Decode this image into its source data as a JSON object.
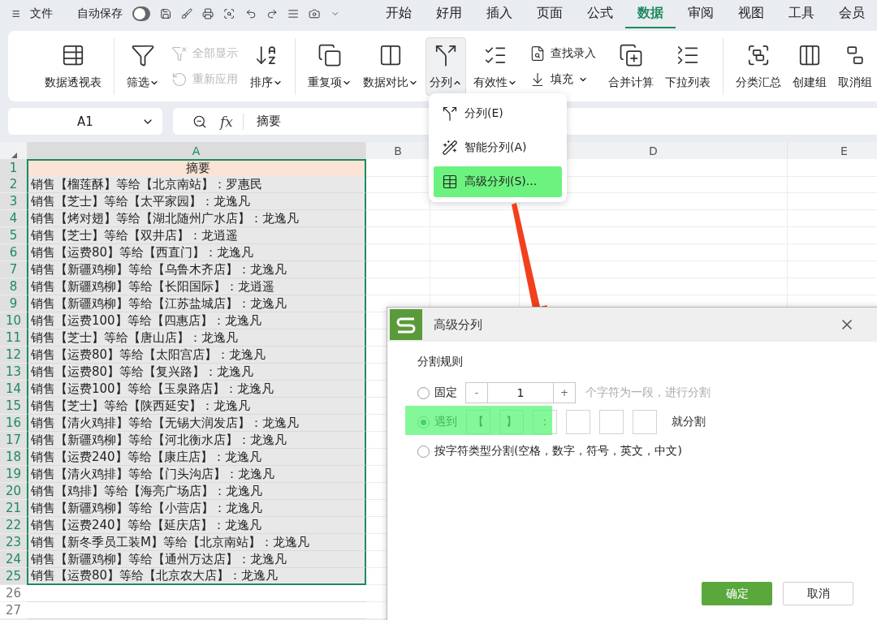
{
  "top_bar": {
    "file_menu": "文件",
    "autosave": {
      "label": "自动保存",
      "on": false
    },
    "tabs": [
      {
        "label": "开始",
        "selected": false
      },
      {
        "label": "好用",
        "selected": false
      },
      {
        "label": "插入",
        "selected": false
      },
      {
        "label": "页面",
        "selected": false
      },
      {
        "label": "公式",
        "selected": false
      },
      {
        "label": "数据",
        "selected": true
      },
      {
        "label": "审阅",
        "selected": false
      },
      {
        "label": "视图",
        "selected": false
      },
      {
        "label": "工具",
        "selected": false
      },
      {
        "label": "会员",
        "selected": false
      }
    ]
  },
  "ribbon": {
    "groups": [
      {
        "items": [
          {
            "kind": "large",
            "label": "数据透视表"
          }
        ]
      },
      {
        "items": [
          {
            "kind": "large",
            "label": "筛选",
            "expanded": false
          },
          {
            "kind": "stack",
            "items": [
              {
                "label": "全部显示",
                "disabled": true
              },
              {
                "label": "重新应用",
                "disabled": true
              }
            ]
          },
          {
            "kind": "large",
            "label": "排序",
            "expanded": false
          }
        ]
      },
      {
        "items": [
          {
            "kind": "large",
            "label": "重复项",
            "expanded": false
          },
          {
            "kind": "large",
            "label": "数据对比",
            "expanded": false
          },
          {
            "kind": "large",
            "label": "分列",
            "expanded": true
          },
          {
            "kind": "large",
            "label": "有效性",
            "expanded": false
          },
          {
            "kind": "stack",
            "items": [
              {
                "label": "查找录入",
                "disabled": false
              },
              {
                "label": "填充",
                "disabled": false,
                "expanded": false
              }
            ]
          },
          {
            "kind": "large",
            "label": "合并计算"
          },
          {
            "kind": "large",
            "label": "下拉列表"
          }
        ]
      },
      {
        "items": [
          {
            "kind": "large",
            "label": "分类汇总"
          },
          {
            "kind": "large",
            "label": "创建组"
          },
          {
            "kind": "large",
            "label": "取消组"
          }
        ]
      }
    ]
  },
  "formula_bar": {
    "name_box": "A1",
    "fx": "fx",
    "value": "摘要"
  },
  "sheet": {
    "columns": [
      {
        "label": "A",
        "selected": true
      },
      {
        "label": "B",
        "selected": false
      },
      {
        "label": "D",
        "selected": false
      },
      {
        "label": "E",
        "selected": false
      }
    ],
    "rows": [
      {
        "number": "1",
        "selected": true,
        "kind": "header",
        "cell": "摘要"
      },
      {
        "number": "2",
        "selected": true,
        "kind": "data",
        "cell": "销售【榴莲酥】等给【北京南站】：罗惠民"
      },
      {
        "number": "3",
        "selected": true,
        "kind": "data",
        "cell": "销售【芝士】等给【太平家园】：龙逸凡"
      },
      {
        "number": "4",
        "selected": true,
        "kind": "data",
        "cell": "销售【烤对翅】等给【湖北随州广水店】：龙逸凡"
      },
      {
        "number": "5",
        "selected": true,
        "kind": "data",
        "cell": "销售【芝士】等给【双井店】：龙逍遥"
      },
      {
        "number": "6",
        "selected": true,
        "kind": "data",
        "cell": "销售【运费80】等给【西直门】：龙逸凡"
      },
      {
        "number": "7",
        "selected": true,
        "kind": "data",
        "cell": "销售【新疆鸡柳】等给【乌鲁木齐店】：龙逸凡"
      },
      {
        "number": "8",
        "selected": true,
        "kind": "data",
        "cell": "销售【新疆鸡柳】等给【长阳国际】：龙逍遥"
      },
      {
        "number": "9",
        "selected": true,
        "kind": "data",
        "cell": "销售【新疆鸡柳】等给【江苏盐城店】：龙逸凡"
      },
      {
        "number": "10",
        "selected": true,
        "kind": "data",
        "cell": "销售【运费100】等给【四惠店】：龙逸凡"
      },
      {
        "number": "11",
        "selected": true,
        "kind": "data",
        "cell": "销售【芝士】等给【唐山店】：龙逸凡"
      },
      {
        "number": "12",
        "selected": true,
        "kind": "data",
        "cell": "销售【运费80】等给【太阳宫店】：龙逸凡"
      },
      {
        "number": "13",
        "selected": true,
        "kind": "data",
        "cell": "销售【运费80】等给【复兴路】：龙逸凡"
      },
      {
        "number": "14",
        "selected": true,
        "kind": "data",
        "cell": "销售【运费100】等给【玉泉路店】：龙逸凡"
      },
      {
        "number": "15",
        "selected": true,
        "kind": "data",
        "cell": "销售【芝士】等给【陕西延安】：龙逸凡"
      },
      {
        "number": "16",
        "selected": true,
        "kind": "data",
        "cell": "销售【清火鸡排】等给【无锡大润发店】：龙逸凡"
      },
      {
        "number": "17",
        "selected": true,
        "kind": "data",
        "cell": "销售【新疆鸡柳】等给【河北衡水店】：龙逸凡"
      },
      {
        "number": "18",
        "selected": true,
        "kind": "data",
        "cell": "销售【运费240】等给【康庄店】：龙逸凡"
      },
      {
        "number": "19",
        "selected": true,
        "kind": "data",
        "cell": "销售【清火鸡排】等给【门头沟店】：龙逸凡"
      },
      {
        "number": "20",
        "selected": true,
        "kind": "data",
        "cell": "销售【鸡排】等给【海亮广场店】：龙逸凡"
      },
      {
        "number": "21",
        "selected": true,
        "kind": "data",
        "cell": "销售【新疆鸡柳】等给【小营店】：龙逸凡"
      },
      {
        "number": "22",
        "selected": true,
        "kind": "data",
        "cell": "销售【运费240】等给【延庆店】：龙逸凡"
      },
      {
        "number": "23",
        "selected": true,
        "kind": "data",
        "cell": "销售【新冬季员工装M】等给【北京南站】：龙逸凡"
      },
      {
        "number": "24",
        "selected": true,
        "kind": "data",
        "cell": "销售【新疆鸡柳】等给【通州万达店】：龙逸凡"
      },
      {
        "number": "25",
        "selected": true,
        "kind": "data",
        "cell": "销售【运费80】等给【北京农大店】：龙逸凡"
      },
      {
        "number": "26",
        "selected": false,
        "kind": "data"
      },
      {
        "number": "27",
        "selected": false,
        "kind": "data"
      }
    ]
  },
  "split_menu": {
    "items": [
      {
        "label": "分列(E)",
        "selected": false
      },
      {
        "label": "智能分列(A)",
        "selected": false
      },
      {
        "label": "高级分列(S)...",
        "selected": true
      }
    ]
  },
  "dialog": {
    "title": "高级分列",
    "section": "分割规则",
    "options": [
      {
        "kind": "fixed",
        "label": "固定",
        "selected": false,
        "minus": "-",
        "value": "1",
        "plus": "+",
        "suffix": "个字符为一段，进行分割"
      },
      {
        "kind": "delimiter",
        "label": "遇到",
        "selected": true,
        "delimiters": [
          "【",
          "】",
          "："
        ],
        "suffix": "就分割"
      },
      {
        "kind": "type",
        "label": "按字符类型分割(空格，数字，符号，英文，中文)",
        "selected": false
      }
    ],
    "buttons": [
      {
        "label": "确定",
        "kind": "primary"
      },
      {
        "label": "取消",
        "kind": "secondary"
      }
    ]
  }
}
